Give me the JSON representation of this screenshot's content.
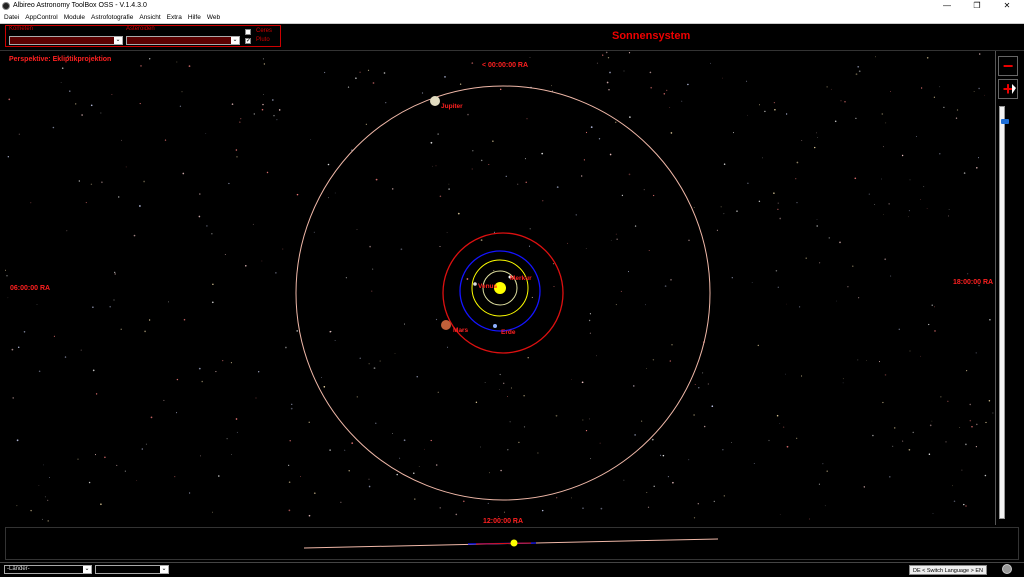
{
  "window": {
    "title": "Albireo Astronomy ToolBox OSS - V.1.4.3.0",
    "minimize": "—",
    "restore": "❐",
    "close": "✕"
  },
  "menu": [
    "Datei",
    "AppControl",
    "Module",
    "Astrofotografie",
    "Ansicht",
    "Extra",
    "Hilfe",
    "Web"
  ],
  "toolbar": {
    "comets_label": "Kometen",
    "asteroids_label": "Asteroiden",
    "ceres_label": "Ceres",
    "ceres_checked": false,
    "pluto_label": "Pluto",
    "pluto_checked": true
  },
  "heading": "Sonnensystem",
  "sky": {
    "perspective": "Perspektive: Ekliptikprojektion",
    "ra_top": "< 00:00:00 RA",
    "ra_left": "06:00:00 RA",
    "ra_right": "18:00:00 RA",
    "ra_bottom": "12:00:00 RA",
    "planets": {
      "venus": "Venus",
      "merkur": "Merkur",
      "erde": "Erde",
      "mars": "Mars",
      "jupiter": "Jupiter"
    },
    "colors": {
      "sun": "#ffff00",
      "mercury_orbit": "#e0e0a0",
      "venus_orbit": "#ffff00",
      "earth_orbit": "#1414ff",
      "mars_orbit": "#dd1010",
      "jupiter_orbit": "#f0b8a8",
      "label": "#ff2020"
    }
  },
  "zoom": {
    "minus": "−",
    "plus": "+",
    "level": 0.03
  },
  "status": {
    "countries": "-Länder-",
    "language_button": "DE < Switch Language > EN"
  }
}
